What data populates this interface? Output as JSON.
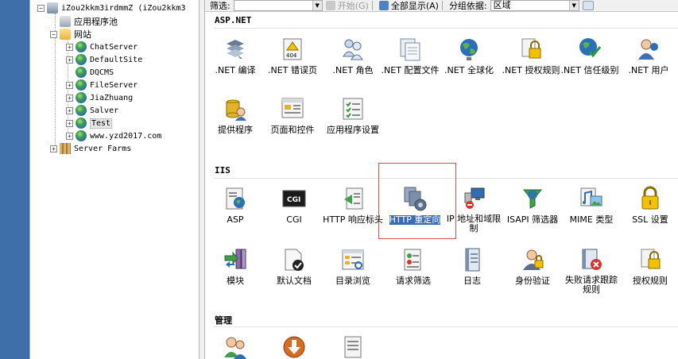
{
  "tree": {
    "nodes": [
      {
        "label": "iZou2kkm3irdmmZ (iZou2kkm3",
        "depth": 0,
        "expander": "-",
        "icon": "server-icon",
        "cn": false
      },
      {
        "label": "应用程序池",
        "depth": 1,
        "expander": "",
        "icon": "app-pool-icon",
        "cn": true
      },
      {
        "label": "网站",
        "depth": 1,
        "expander": "-",
        "icon": "sites-folder-icon",
        "cn": true
      },
      {
        "label": "ChatServer",
        "depth": 2,
        "expander": "+",
        "icon": "globe-icon",
        "cn": false
      },
      {
        "label": "DefaultSite",
        "depth": 2,
        "expander": "+",
        "icon": "globe-icon",
        "cn": false
      },
      {
        "label": "DQCMS",
        "depth": 2,
        "expander": "",
        "icon": "globe-icon",
        "cn": false
      },
      {
        "label": "FileServer",
        "depth": 2,
        "expander": "+",
        "icon": "globe-icon",
        "cn": false
      },
      {
        "label": "JiaZhuang",
        "depth": 2,
        "expander": "+",
        "icon": "globe-icon",
        "cn": false
      },
      {
        "label": "Salver",
        "depth": 2,
        "expander": "+",
        "icon": "globe-icon",
        "cn": false
      },
      {
        "label": "Test",
        "depth": 2,
        "expander": "+",
        "icon": "globe-icon",
        "cn": false,
        "selected": true
      },
      {
        "label": "www.yzd2017.com",
        "depth": 2,
        "expander": "+",
        "icon": "globe-icon",
        "cn": false
      },
      {
        "label": "Server Farms",
        "depth": 1,
        "expander": "+",
        "icon": "server-farm-icon",
        "cn": false
      }
    ]
  },
  "toolbar": {
    "filter_label": "筛选:",
    "start_label": "开始(G)",
    "show_all_label": "全部显示(A)",
    "group_by_label": "分组依据:",
    "group_by_value": "区域"
  },
  "groups": {
    "aspnet": {
      "title": "ASP.NET",
      "row1": [
        ".NET 编译",
        ".NET 错误页",
        ".NET 角色",
        ".NET 配置文件",
        ".NET 全球化",
        ".NET 授权规则",
        ".NET 信任级别",
        ".NET 用户"
      ],
      "row2": [
        "提供程序",
        "页面和控件",
        "应用程序设置"
      ]
    },
    "iis": {
      "title": "IIS",
      "row1": [
        "ASP",
        "CGI",
        "HTTP 响应标头",
        "HTTP 重定向",
        "IP 地址和域限制",
        "ISAPI 筛选器",
        "MIME 类型",
        "SSL 设置"
      ],
      "row2": [
        "模块",
        "默认文档",
        "目录浏览",
        "请求筛选",
        "日志",
        "身份验证",
        "失败请求跟踪规则",
        "授权规则"
      ]
    },
    "manage": {
      "title": "管理"
    }
  },
  "colors": {
    "left_strip": "#3e6fa9",
    "selection": "#3a6bb5",
    "highlight_box": "#d9534f"
  }
}
